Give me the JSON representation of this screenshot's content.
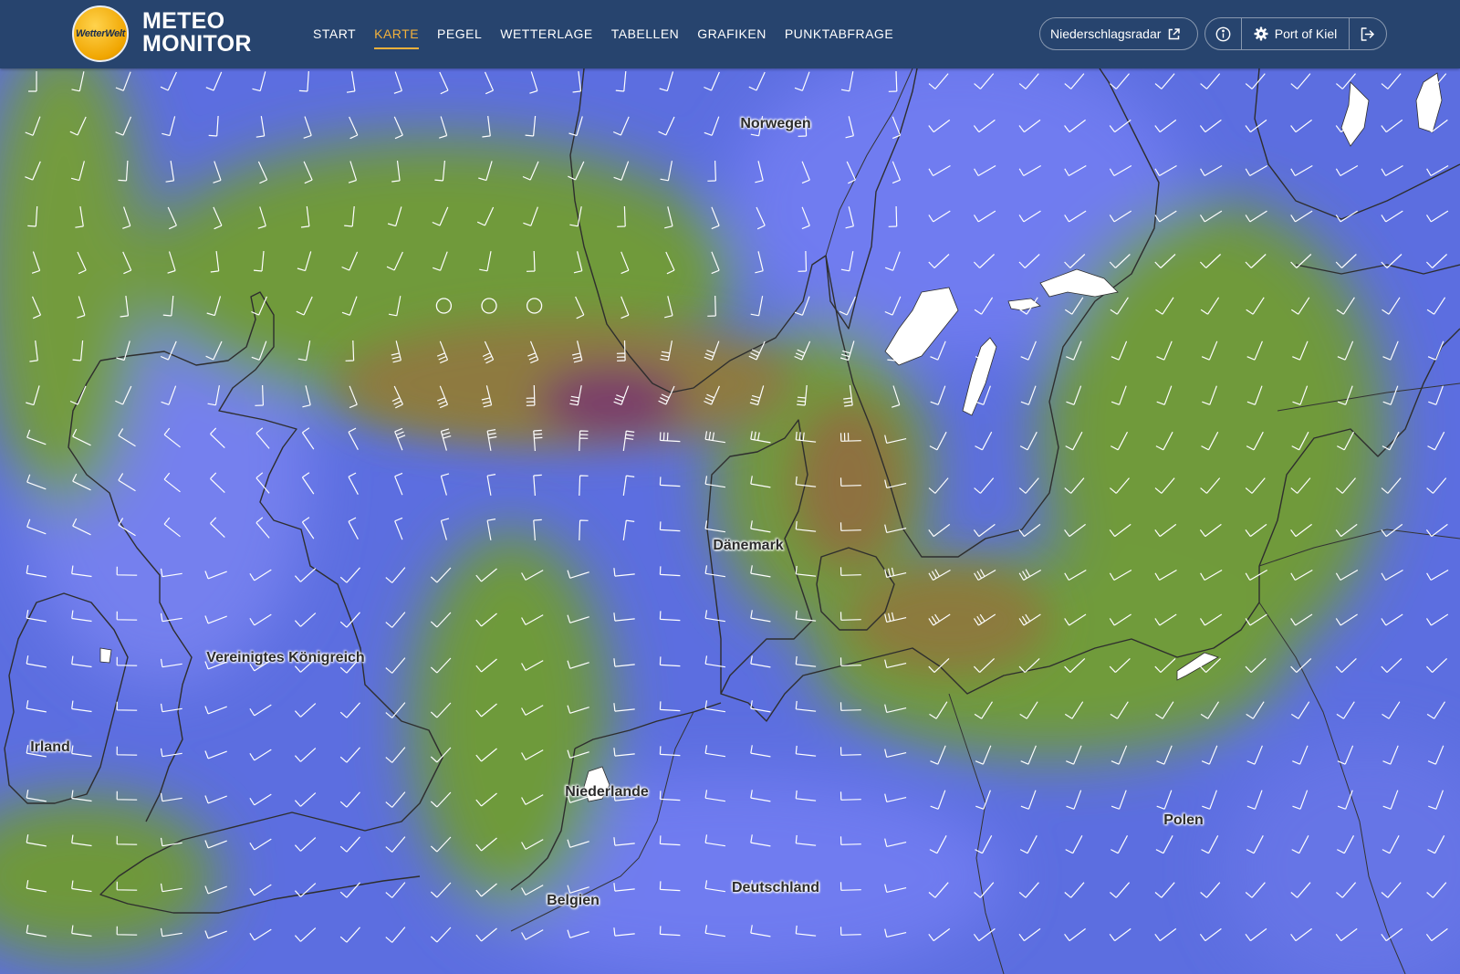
{
  "header": {
    "logo_text": "WetterWelt",
    "brand_line1": "METEO",
    "brand_line2": "MONITOR",
    "nav": [
      {
        "label": "START",
        "active": false
      },
      {
        "label": "KARTE",
        "active": true
      },
      {
        "label": "PEGEL",
        "active": false
      },
      {
        "label": "WETTERLAGE",
        "active": false
      },
      {
        "label": "TABELLEN",
        "active": false
      },
      {
        "label": "GRAFIKEN",
        "active": false
      },
      {
        "label": "PUNKTABFRAGE",
        "active": false
      }
    ],
    "radar_button": "Niederschlagsradar",
    "radar_icon": "external-link-icon",
    "info_icon": "info-icon",
    "settings_icon": "gear-icon",
    "port_label": "Port of Kiel",
    "logout_icon": "logout-icon",
    "accent_color": "#f3b13b",
    "bar_color": "#27446e"
  },
  "map": {
    "labels": {
      "norwegen": "Norwegen",
      "daenemark": "Dänemark",
      "vk": "Vereinigtes Königreich",
      "irland": "Irland",
      "niederlande": "Niederlande",
      "polen": "Polen",
      "belgien": "Belgien",
      "deutschland": "Deutschland"
    },
    "colors": {
      "calm": "#6f7cf0",
      "light": "#5a70d8",
      "moderate": "#6e9e3c",
      "strong": "#8c7a3e",
      "very_strong": "#7a3a6a",
      "land_outline": "#2e2e2e",
      "lakes": "#ffffff",
      "wind_symbol": "#ffffff"
    }
  }
}
